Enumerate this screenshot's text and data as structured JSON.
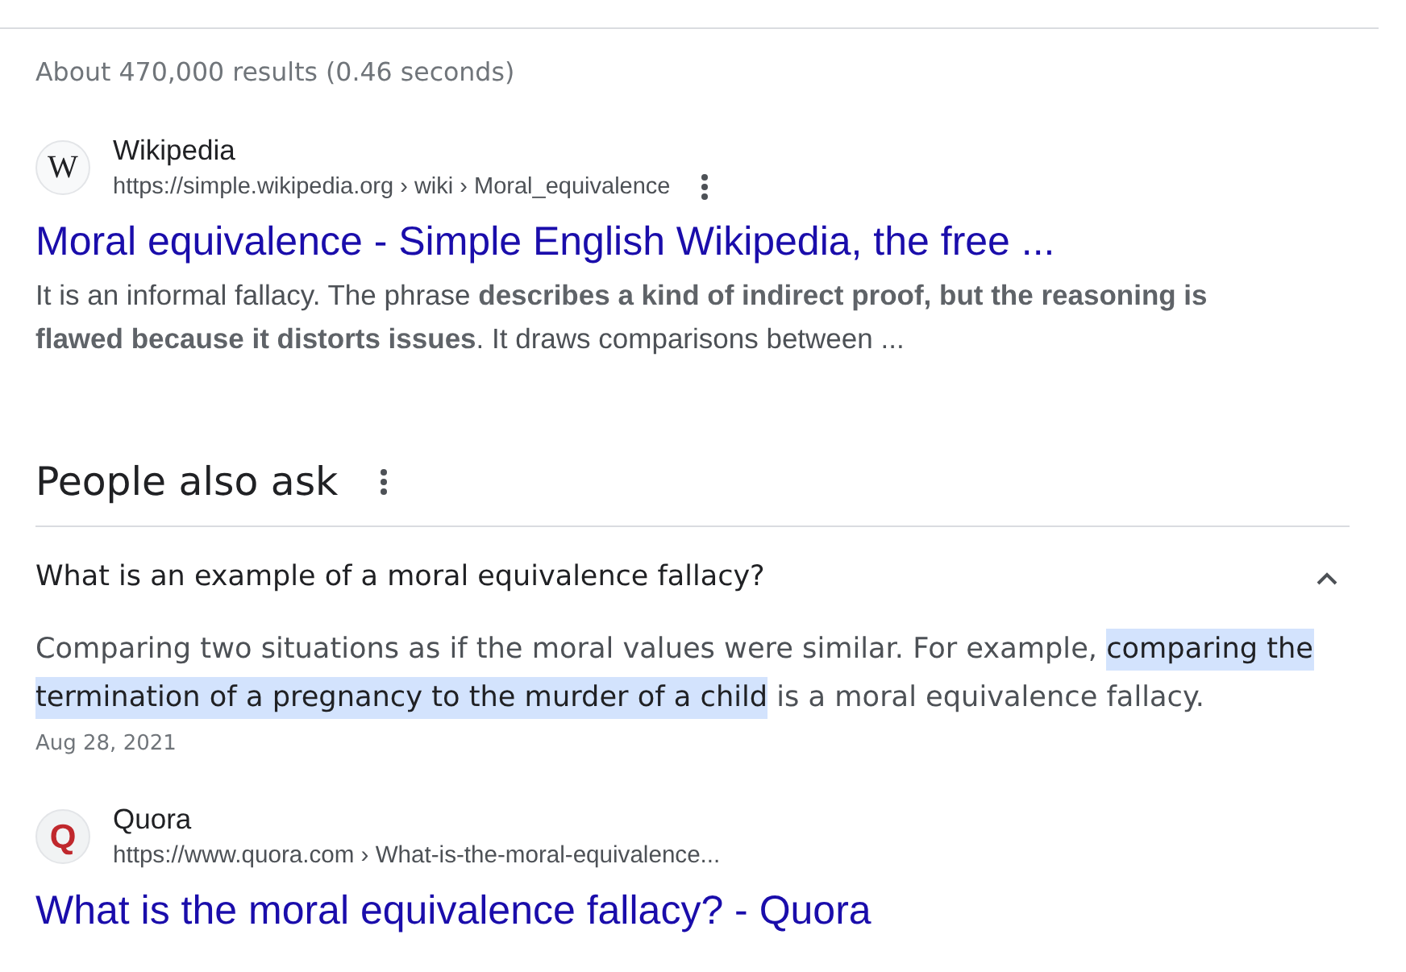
{
  "stats": "About 470,000 results (0.46 seconds)",
  "result": {
    "favicon": "W",
    "site_name": "Wikipedia",
    "url": "https://simple.wikipedia.org › wiki › Moral_equivalence",
    "title": "Moral equivalence - Simple English Wikipedia, the free ...",
    "snippet": "It is an informal fallacy. The phrase **describes a kind of indirect proof, but the reasoning is flawed because it distorts issues**. It draws comparisons between ..."
  },
  "people_also_ask": {
    "heading": "People also ask",
    "questions": [
      {
        "text": "What is an example of a moral equivalence fallacy?",
        "expanded": true,
        "answer": [
          {
            "text": "Comparing two situations as if the moral values were similar. For example, ",
            "highlighted": false
          },
          {
            "text": "comparing the termination of a pregnancy to the murder of a child",
            "highlighted": true
          },
          {
            "text": " is a moral equivalence fallacy.",
            "highlighted": false
          }
        ],
        "date": "Aug 28, 2021",
        "source": {
          "favicon": "Q",
          "site_name": "Quora",
          "url": "https://www.quora.com › What-is-the-moral-equivalence...",
          "title": "What is the moral equivalence fallacy? - Quora"
        }
      }
    ]
  }
}
